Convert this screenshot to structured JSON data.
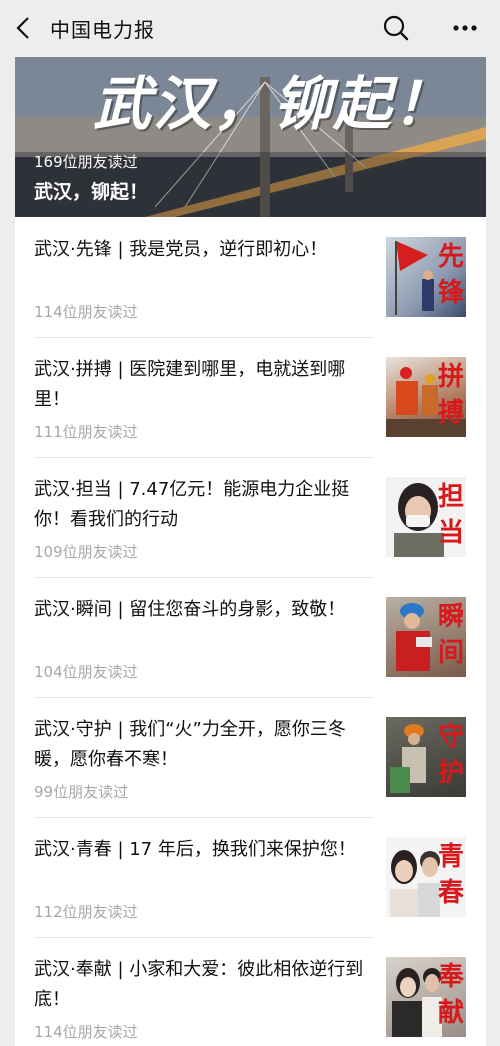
{
  "header": {
    "title": "中国电力报",
    "back_icon": "chevron-left-icon",
    "search_icon": "search-icon",
    "more_icon": "more-dots-icon"
  },
  "hero": {
    "banner_text": "武汉，铆起！",
    "read_count": "169位朋友读过",
    "title": "武汉，铆起！"
  },
  "articles": [
    {
      "title": "武汉·先锋 | 我是党员，逆行即初心！",
      "read_count": "114位朋友读过",
      "thumb_text": "先锋"
    },
    {
      "title": "武汉·拼搏 | 医院建到哪里，电就送到哪里！",
      "read_count": "111位朋友读过",
      "thumb_text": "拼搏"
    },
    {
      "title": "武汉·担当 | 7.47亿元！能源电力企业挺你！看我们的行动",
      "read_count": "109位朋友读过",
      "thumb_text": "担当"
    },
    {
      "title": "武汉·瞬间 | 留住您奋斗的身影，致敬！",
      "read_count": "104位朋友读过",
      "thumb_text": "瞬间"
    },
    {
      "title": "武汉·守护 | 我们“火”力全开，愿你三冬暖，愿你春不寒！",
      "read_count": "99位朋友读过",
      "thumb_text": "守护"
    },
    {
      "title": "武汉·青春 | 17 年后，换我们来保护您！",
      "read_count": "112位朋友读过",
      "thumb_text": "青春"
    },
    {
      "title": "武汉·奉献 | 小家和大爱：彼此相依逆行到底！",
      "read_count": "114位朋友读过",
      "thumb_text": "奉献"
    }
  ]
}
